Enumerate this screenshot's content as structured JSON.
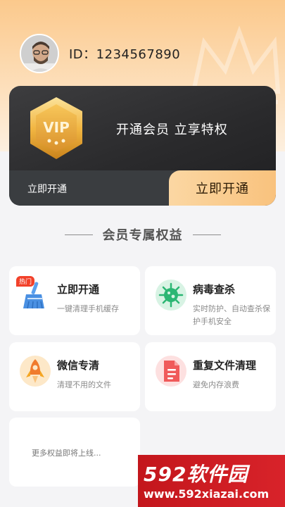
{
  "profile": {
    "id_text": "ID：1234567890"
  },
  "vip_card": {
    "badge_text": "VIP",
    "slogan": "开通会员  立享特权",
    "bottom_label": "立即开通",
    "open_button": "立即开通"
  },
  "section": {
    "title": "会员专属权益"
  },
  "benefits": [
    {
      "title": "立即开通",
      "desc": "一键清理手机缓存",
      "tag": "热门",
      "icon": "broom-icon",
      "color": "#4a90e2"
    },
    {
      "title": "病毒查杀",
      "desc": "实时防护、自动查杀保护手机安全",
      "icon": "virus-icon",
      "color": "#2bb673"
    },
    {
      "title": "微信专清",
      "desc": "清理不用的文件",
      "icon": "rocket-icon",
      "color": "#f5a623"
    },
    {
      "title": "重复文件清理",
      "desc": "避免内存浪费",
      "icon": "document-icon",
      "color": "#f05a5a"
    }
  ],
  "more": {
    "text": "更多权益即将上线..."
  },
  "watermark": {
    "logo": "592软件园",
    "url": "www.592xiazai.com"
  }
}
